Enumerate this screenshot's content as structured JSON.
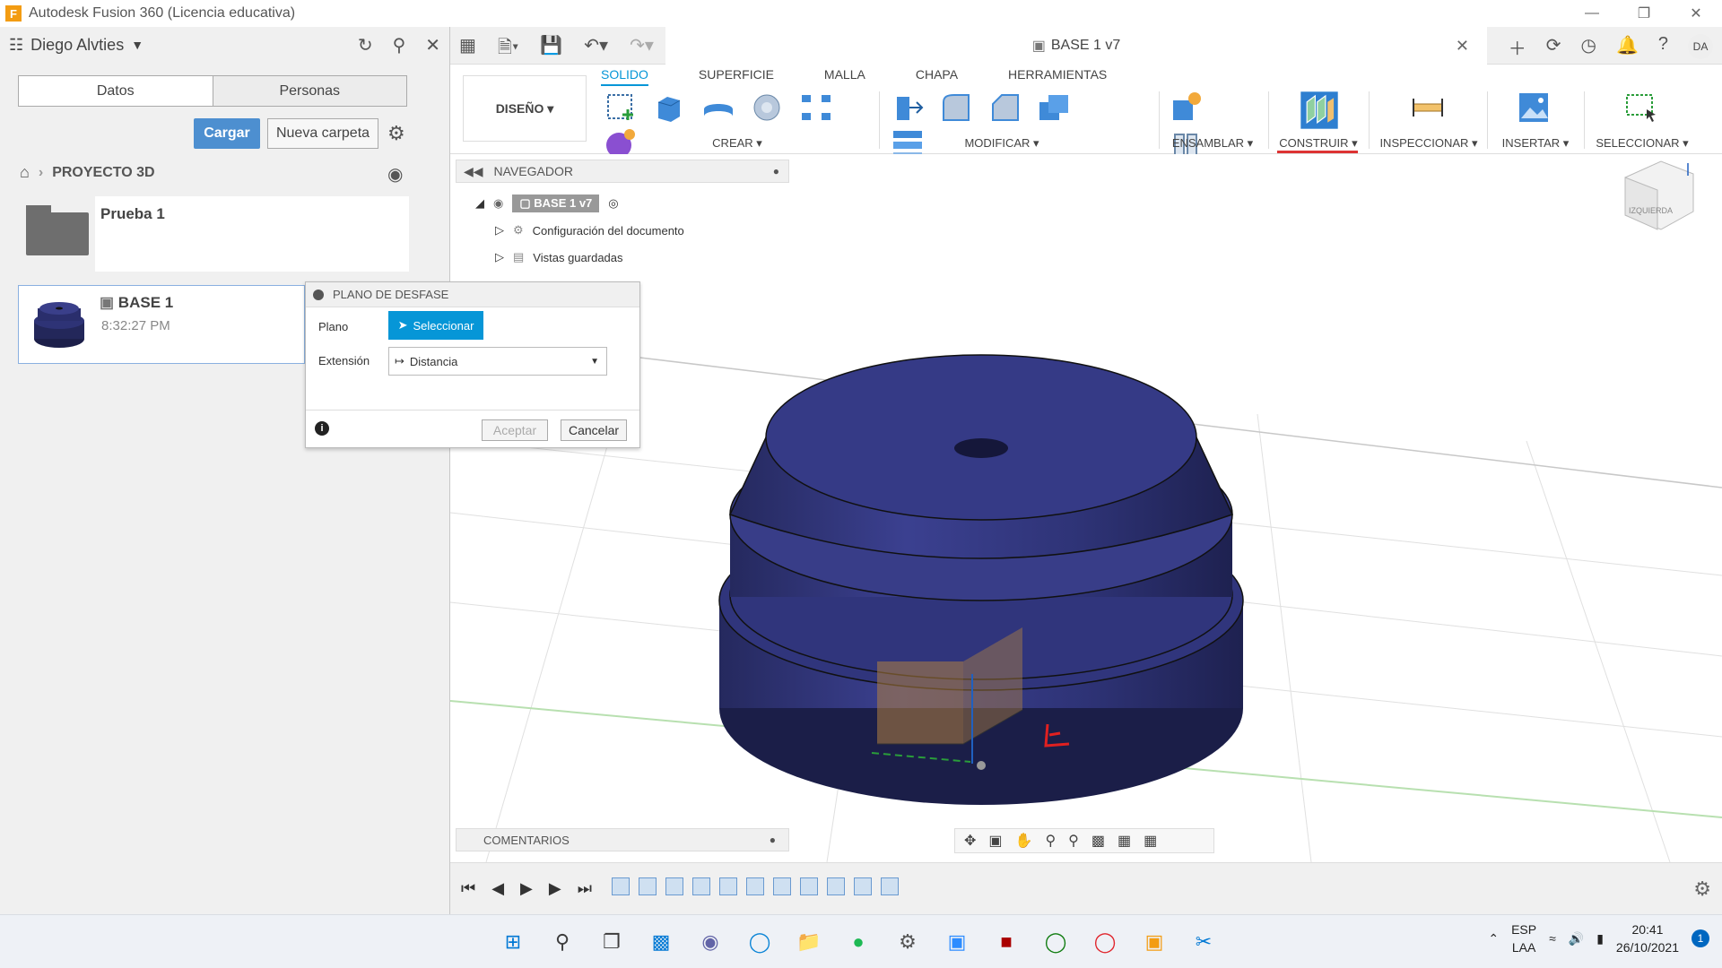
{
  "window": {
    "title": "Autodesk Fusion 360 (Licencia educativa)"
  },
  "data_panel": {
    "user": "Diego Alvties",
    "tabs": [
      "Datos",
      "Personas"
    ],
    "upload_label": "Cargar",
    "new_folder_label": "Nueva carpeta",
    "breadcrumb": "PROYECTO 3D",
    "items": [
      {
        "name": "Prueba 1",
        "time": ""
      },
      {
        "name": "BASE 1",
        "time": "8:32:27 PM"
      }
    ]
  },
  "document_tab": {
    "title": "BASE 1 v7",
    "user_initials": "DA"
  },
  "toolbar": {
    "workspace": "DISEÑO",
    "ribbon_tabs": [
      "SOLIDO",
      "SUPERFICIE",
      "MALLA",
      "CHAPA",
      "HERRAMIENTAS"
    ],
    "active_tab": "SOLIDO",
    "groups": {
      "crear": "CREAR",
      "modificar": "MODIFICAR",
      "ensamblar": "ENSAMBLAR",
      "construir": "CONSTRUIR",
      "inspeccionar": "INSPECCIONAR",
      "insertar": "INSERTAR",
      "seleccionar": "SELECCIONAR"
    }
  },
  "navigator": {
    "title": "NAVEGADOR",
    "root": "BASE 1 v7",
    "items": [
      "Configuración del documento",
      "Vistas guardadas"
    ]
  },
  "dialog": {
    "title": "PLANO DE DESFASE",
    "plane_label": "Plano",
    "select_label": "Seleccionar",
    "extent_label": "Extensión",
    "extent_value": "Distancia",
    "ok_label": "Aceptar",
    "cancel_label": "Cancelar"
  },
  "viewcube": {
    "label": "IZQUIERDA"
  },
  "comments": {
    "title": "COMENTARIOS"
  },
  "taskbar": {
    "lang_top": "ESP",
    "lang_bottom": "LAA",
    "time": "20:41",
    "date": "26/10/2021",
    "notifications": "1"
  },
  "colors": {
    "accent": "#0696d7",
    "body": "#2e3376",
    "construir_underline": "#dd3333"
  }
}
